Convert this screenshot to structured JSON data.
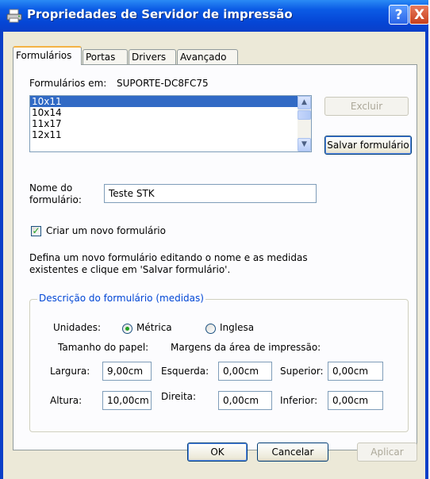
{
  "window": {
    "title": "Propriedades de Servidor de impressão",
    "help_label": "?",
    "close_label": "X"
  },
  "tabs": [
    {
      "label": "Formulários",
      "active": true
    },
    {
      "label": "Portas",
      "active": false
    },
    {
      "label": "Drivers",
      "active": false
    },
    {
      "label": "Avançado",
      "active": false
    }
  ],
  "forms_on": {
    "label": "Formulários em:",
    "server": "SUPORTE-DC8FC75"
  },
  "forms_list": {
    "items": [
      "10x11",
      "10x14",
      "11x17",
      "12x11"
    ],
    "selected": "10x11"
  },
  "buttons": {
    "delete": "Excluir",
    "save_form": "Salvar formulário",
    "ok": "OK",
    "cancel": "Cancelar",
    "apply": "Aplicar"
  },
  "form_name": {
    "label_line1": "Nome do",
    "label_line2": "formulário:",
    "value": "Teste STK"
  },
  "create_new": {
    "label": "Criar um novo formulário",
    "checked": true
  },
  "description": {
    "line1": "Defina um novo formulário editando o nome e as medidas",
    "line2": "existentes e clique em 'Salvar formulário'."
  },
  "measures": {
    "group_title": "Descrição do formulário (medidas)",
    "units_label": "Unidades:",
    "metric_label": "Métrica",
    "english_label": "Inglesa",
    "selected_unit": "Métrica",
    "paper_size_label": "Tamanho do papel:",
    "margins_label": "Margens da área de impressão:",
    "width_label": "Largura:",
    "width_value": "9,00cm",
    "height_label": "Altura:",
    "height_value": "10,00cm",
    "left_label": "Esquerda:",
    "left_value": "0,00cm",
    "right_label": "Direita:",
    "right_value": "0,00cm",
    "top_label": "Superior:",
    "top_value": "0,00cm",
    "bottom_label": "Inferior:",
    "bottom_value": "0,00cm"
  },
  "colors": {
    "title_blue": "#0a3fc8",
    "dialog_face": "#ece9d8",
    "selection": "#316ac5",
    "group_title": "#0046d5",
    "check_green": "#21a121"
  }
}
